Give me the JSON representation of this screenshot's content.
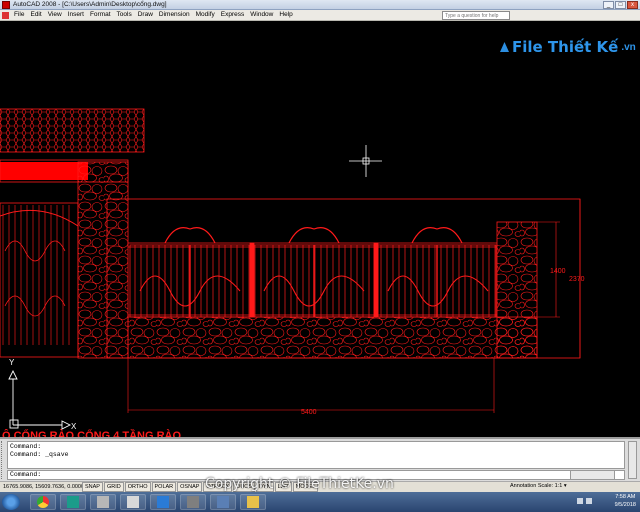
{
  "window": {
    "title": "AutoCAD 2008 - [C:\\Users\\Admin\\Desktop\\cổng.dwg]",
    "help_placeholder": "Type a question for help"
  },
  "menu": {
    "items": [
      "File",
      "Edit",
      "View",
      "Insert",
      "Format",
      "Tools",
      "Draw",
      "Dimension",
      "Modify",
      "Express",
      "Window",
      "Help"
    ]
  },
  "drawing": {
    "dim_height_1": "1400",
    "dim_height_2": "2370",
    "dim_width": "5400",
    "axis_y": "Y",
    "axis_x": "X",
    "cad_color": "#ff0000",
    "bottom_caption": "Ô CỔNG RÀO CỔNG 4 TẦNG RÀO"
  },
  "watermark": {
    "logo_text": "File Thiết Kế",
    "logo_suffix": ".vn",
    "copyright": "Copyright © FileThietKe.vn"
  },
  "command": {
    "history": [
      "Command:",
      "Command:  _qsave"
    ],
    "prompt": "Command:"
  },
  "status": {
    "coords": "16765.9086, 15609.7636, 0.0000",
    "toggles": [
      "SNAP",
      "GRID",
      "ORTHO",
      "POLAR",
      "OSNAP",
      "OTRACK",
      "DUCS",
      "DYN",
      "LWT",
      "MODEL"
    ],
    "annotation_scale": "Annotation Scale:  1:1 ▾"
  },
  "taskbar": {
    "time": "7:58 AM",
    "date": "9/5/2018",
    "apps": [
      "chrome-icon",
      "autocad-icon",
      "app-icon",
      "app-icon",
      "app-icon",
      "app-icon",
      "app-icon",
      "app-icon"
    ]
  }
}
